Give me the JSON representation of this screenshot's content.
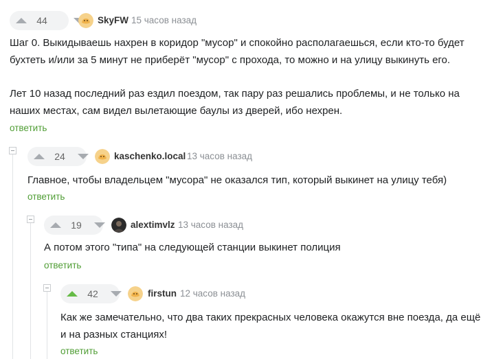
{
  "comments": [
    {
      "votes": "44",
      "username": "SkyFW",
      "time": "15 часов назад",
      "paragraph1_line1": "Шаг 0. Выкидываешь нахрен в коридор \"мусор\" и спокойно располагаешься, если кто-то будет",
      "paragraph1_line2": "бухтеть и/или за 5 минут не приберёт \"мусор\" с прохода, то можно и на улицу выкинуть его.",
      "paragraph2_line1": "Лет 10 назад последний раз ездил поездом, так пару раз решались проблемы, и не только на",
      "paragraph2_line2": "наших местах, сам видел вылетающие баулы из дверей, ибо нехрен.",
      "reply": "ответить"
    },
    {
      "votes": "24",
      "username": "kaschenko.local",
      "time": "13 часов назад",
      "line1": "Главное, чтобы владельцем \"мусора\" не оказался тип, который выкинет на улицу тебя)",
      "reply": "ответить"
    },
    {
      "votes": "19",
      "username": "alextimvlz",
      "time": "13 часов назад",
      "line1": "А потом этого \"типа\" на следующей станции выкинет полиция",
      "reply": "ответить"
    },
    {
      "votes": "42",
      "username": "firstun",
      "time": "12 часов назад",
      "line1": "Как же замечательно, что два таких прекрасных человека окажутся вне поезда, да ещё",
      "line2": "и на разных станциях!",
      "reply": "ответить"
    }
  ],
  "colors": {
    "accent_green": "#4f9d34",
    "upvote_active": "#66bb47",
    "pill_bg": "#f2f3f4"
  }
}
